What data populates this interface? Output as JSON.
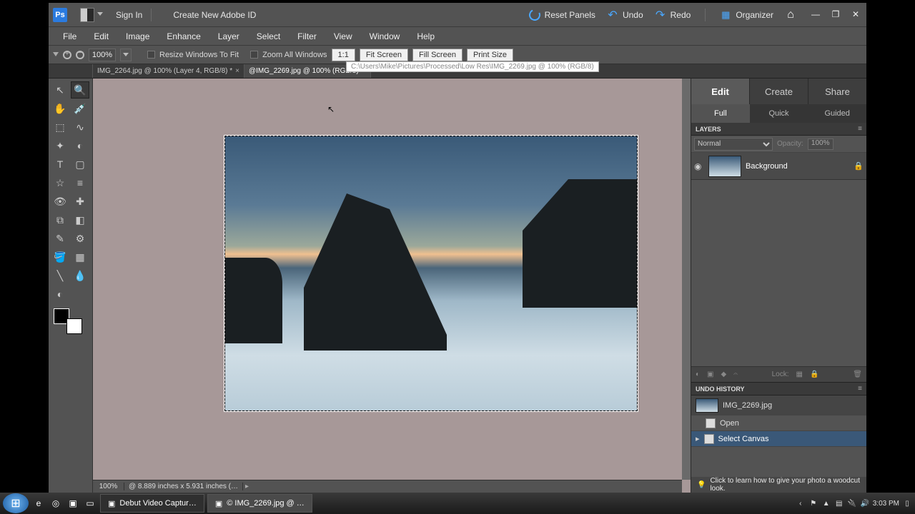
{
  "titlebar": {
    "sign_in": "Sign In",
    "create_id": "Create New Adobe ID",
    "reset": "Reset Panels",
    "undo": "Undo",
    "redo": "Redo",
    "organizer": "Organizer"
  },
  "menubar": [
    "File",
    "Edit",
    "Image",
    "Enhance",
    "Layer",
    "Select",
    "Filter",
    "View",
    "Window",
    "Help"
  ],
  "optbar": {
    "zoom": "100%",
    "resize_windows": "Resize Windows To Fit",
    "zoom_all": "Zoom All Windows",
    "btn_1_1": "1:1",
    "btn_fit": "Fit Screen",
    "btn_fill": "Fill Screen",
    "btn_print": "Print Size",
    "tooltip": "C:\\Users\\Mike\\Pictures\\Processed\\Low Res\\IMG_2269.jpg @ 100% (RGB/8)"
  },
  "doctabs": [
    {
      "label": "IMG_2264.jpg @ 100% (Layer 4, RGB/8) *",
      "active": false
    },
    {
      "label": "@IMG_2269.jpg @ 100% (RGB/8)",
      "active": true
    }
  ],
  "tools": {
    "names": [
      [
        "move-tool",
        "zoom-tool"
      ],
      [
        "hand-tool",
        "eyedropper-tool"
      ],
      [
        "marquee-tool",
        "lasso-tool"
      ],
      [
        "magic-wand-tool",
        "quick-selection-tool"
      ],
      [
        "type-tool",
        "crop-tool"
      ],
      [
        "cookie-cutter-tool",
        "straighten-tool"
      ],
      [
        "red-eye-tool",
        "spot-healing-tool"
      ],
      [
        "clone-stamp-tool",
        "eraser-tool"
      ],
      [
        "brush-tool",
        "smart-brush-tool"
      ],
      [
        "paint-bucket-tool",
        "gradient-tool"
      ],
      [
        "shape-tool",
        "blur-tool"
      ],
      [
        "sponge-tool",
        ""
      ]
    ],
    "glyphs": [
      [
        "↖",
        "🔍"
      ],
      [
        "✋",
        "💉"
      ],
      [
        "⬚",
        "∿"
      ],
      [
        "✦",
        "◐"
      ],
      [
        "T",
        "▢"
      ],
      [
        "☆",
        "≡"
      ],
      [
        "👁",
        "✚"
      ],
      [
        "⧉",
        "◧"
      ],
      [
        "✎",
        "⚙"
      ],
      [
        "🪣",
        "▦"
      ],
      [
        "╲",
        "💧"
      ],
      [
        "◐",
        ""
      ]
    ],
    "selected": "zoom-tool"
  },
  "status": {
    "zoom": "100%",
    "info": "@ 8.889 inches x 5.931 inches (…"
  },
  "modes": [
    "Edit",
    "Create",
    "Share"
  ],
  "mode_active": 0,
  "submodes": [
    "Full",
    "Quick",
    "Guided"
  ],
  "submode_active": 0,
  "panels": {
    "layers_title": "LAYERS",
    "blend": "Normal",
    "opacity_lbl": "Opacity:",
    "opacity_val": "100%",
    "layer_name": "Background",
    "lock_lbl": "Lock:",
    "undo_title": "UNDO HISTORY",
    "hist_file": "IMG_2269.jpg",
    "hist_items": [
      {
        "label": "Open",
        "sel": false
      },
      {
        "label": "Select Canvas",
        "sel": true
      }
    ]
  },
  "tip": "Click to learn how to give your photo a woodcut look.",
  "taskbar": {
    "items": [
      {
        "label": "Debut Video Captur…",
        "active": false
      },
      {
        "label": "© IMG_2269.jpg @ …",
        "active": true
      }
    ],
    "time": "3:03 PM"
  }
}
